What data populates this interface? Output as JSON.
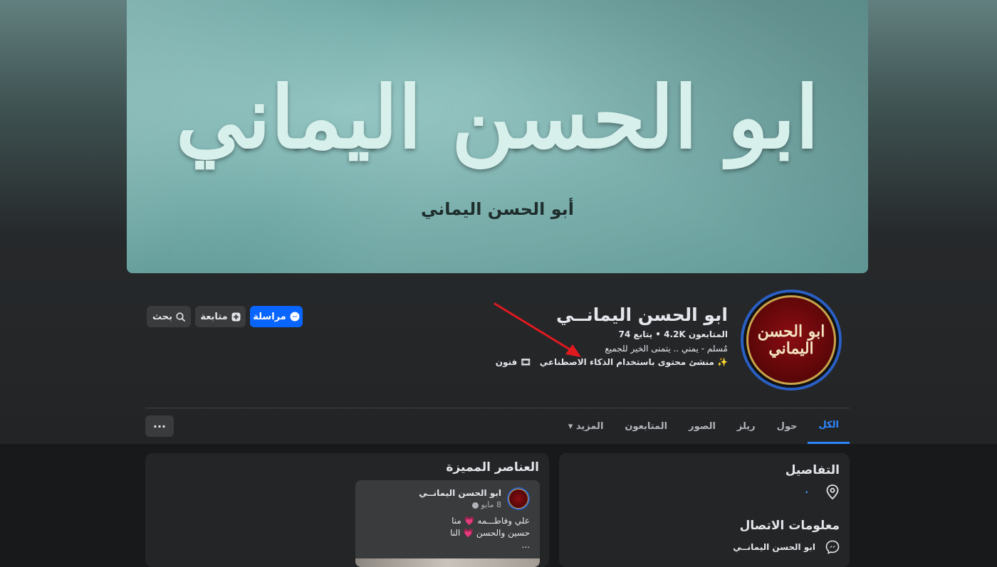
{
  "cover": {
    "title": "ابو الحسن اليماني",
    "subtitle": "أبو الحسن اليماني"
  },
  "avatar": {
    "text": "ابو الحسن اليماني"
  },
  "profile": {
    "name": "ابو الحسن اليمانــي",
    "stats": "المتابعون 4.2K • يتابع 74",
    "bio": "مُسلم - يمني .. يتمنى الخير للجميع",
    "tag_creator": "✨ منشئ محتوى باستخدام الذكاء الاصطناعي",
    "tag_arts": "🎞 فنون"
  },
  "actions": {
    "message_label": "مراسلة",
    "follow_label": "متابعة",
    "search_label": "بحث"
  },
  "tabs": [
    {
      "label": "الكل",
      "active": true
    },
    {
      "label": "حول"
    },
    {
      "label": "ريلز"
    },
    {
      "label": "الصور"
    },
    {
      "label": "المتابعون"
    },
    {
      "label": "المزيد ▾"
    }
  ],
  "more_button": "···",
  "details": {
    "title": "التفاصيل",
    "location_text": "·",
    "contact_title": "معلومات الاتصال",
    "messenger_name": "ابو الحسن اليمانــي"
  },
  "featured": {
    "title": "العناصر المميزة",
    "post": {
      "author": "ابو الحسن اليمانــي",
      "date": "8 مايو",
      "line1": "علي وفاطـــمه 💗 منا",
      "line2": "حسين والحسن 💗 النا",
      "line3": "..."
    }
  },
  "colors": {
    "accent": "#0866ff",
    "tab_active": "#2d88ff",
    "card_bg": "#242526",
    "button_bg": "#3a3b3c"
  }
}
